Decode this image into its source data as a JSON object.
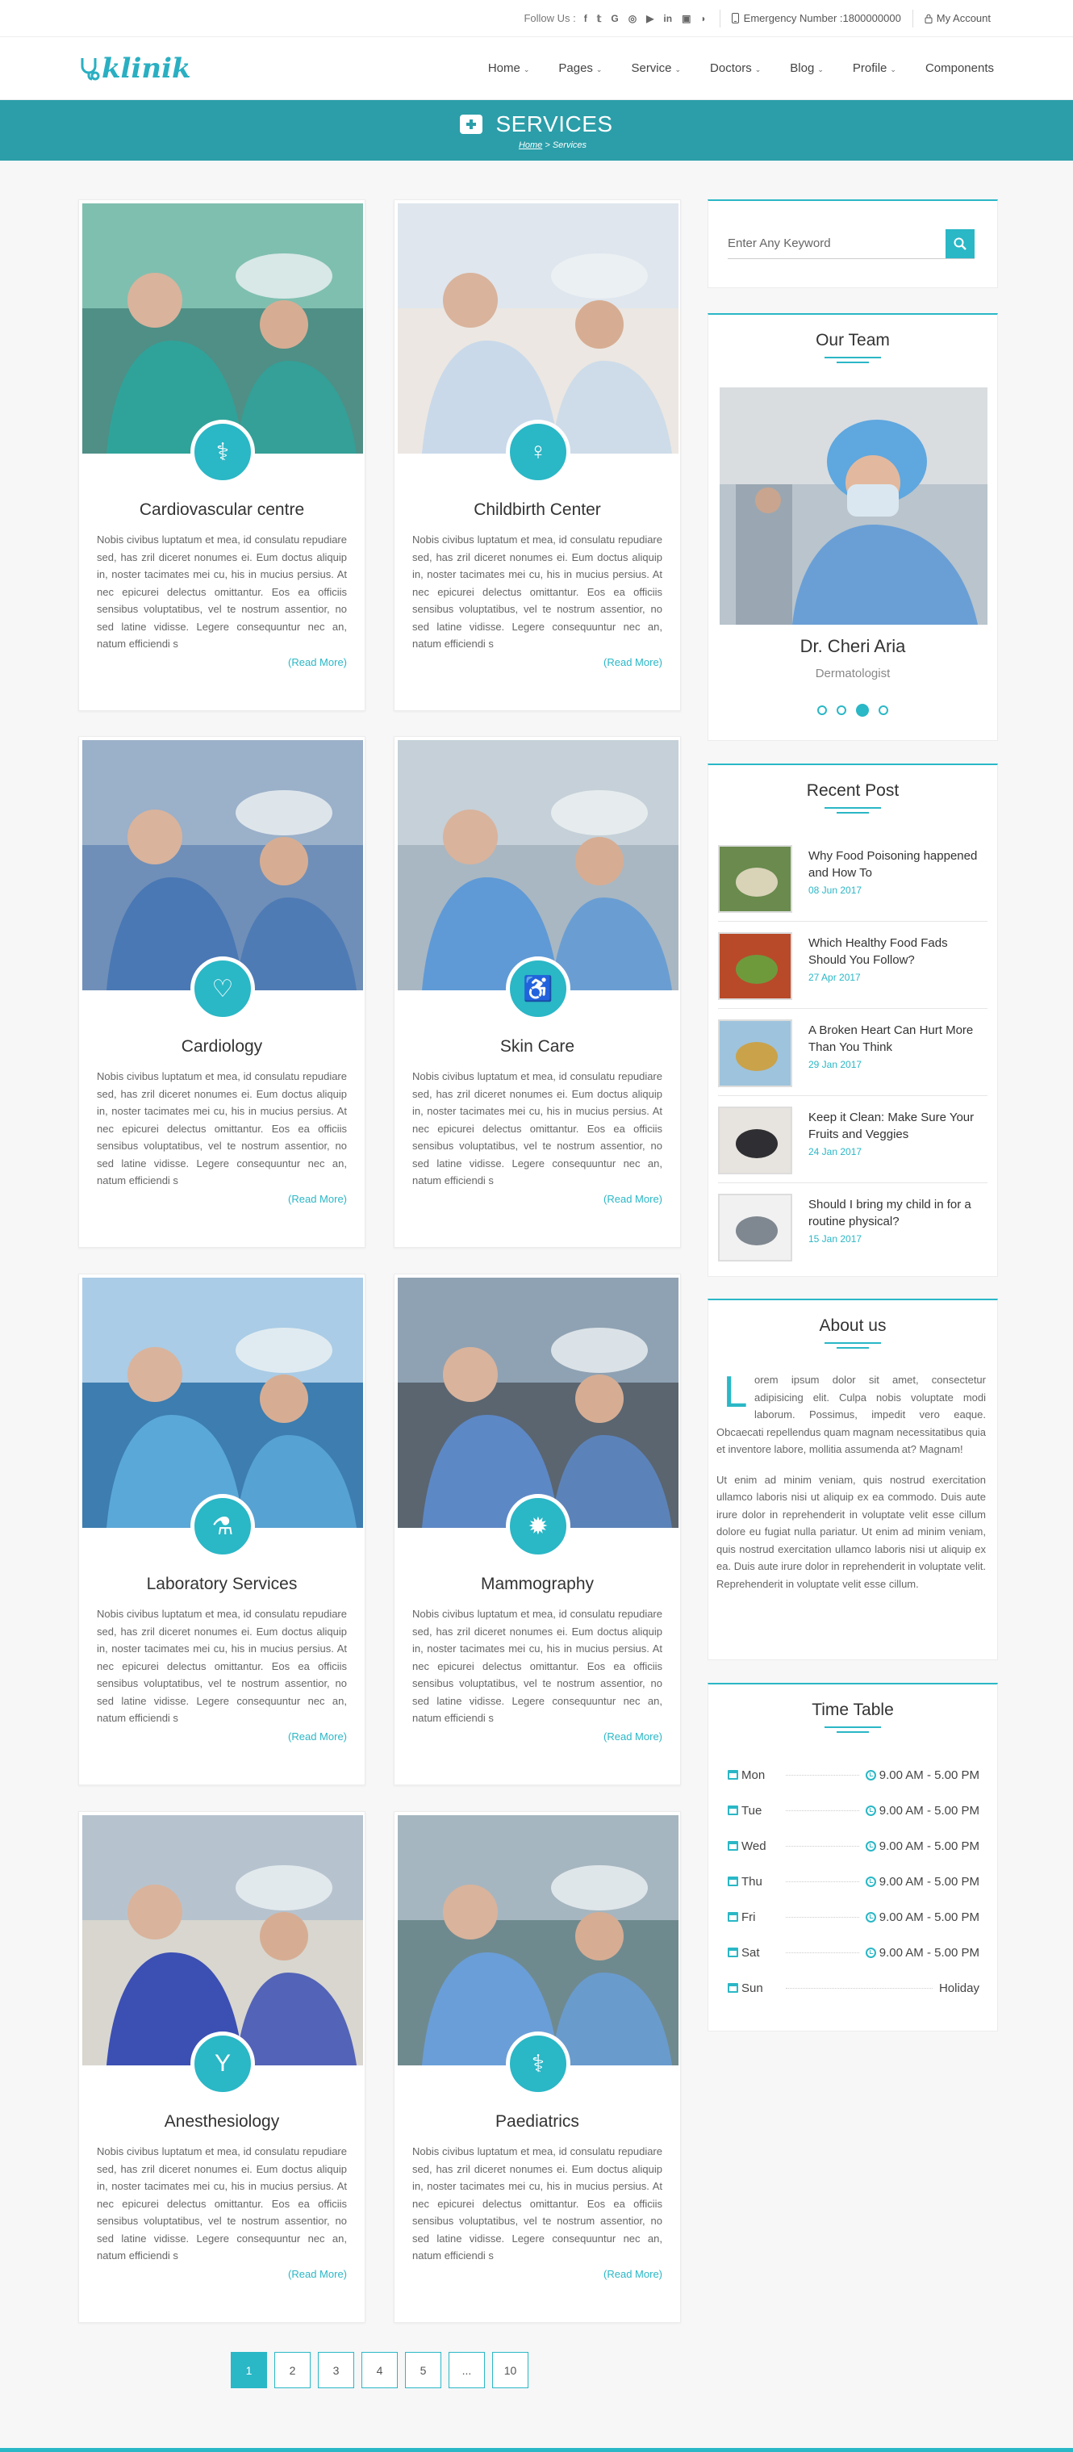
{
  "topbar": {
    "follow_label": "Follow Us :",
    "social_icons": [
      "facebook-icon",
      "twitter-icon",
      "google-icon",
      "instagram-icon",
      "youtube-icon",
      "linkedin-icon",
      "vimeo-icon",
      "rss-icon"
    ],
    "social_glyphs": [
      "f",
      "𝕥",
      "G",
      "◎",
      "▶",
      "in",
      "▣",
      "◗"
    ],
    "emergency": "Emergency Number :1800000000",
    "account": "My Account"
  },
  "header": {
    "logo": "klinik",
    "nav": [
      "Home",
      "Pages",
      "Service",
      "Doctors",
      "Blog",
      "Profile",
      "Components"
    ]
  },
  "banner": {
    "title": "SERVICES",
    "crumb_home": "Home",
    "crumb_sep": " > ",
    "crumb_current": "Services"
  },
  "services": [
    {
      "title": "Cardiovascular centre",
      "icon": "stethoscope-icon",
      "glyph": "⚕"
    },
    {
      "title": "Childbirth Center",
      "icon": "child-icon",
      "glyph": "♀"
    },
    {
      "title": "Cardiology",
      "icon": "heartbeat-icon",
      "glyph": "♡"
    },
    {
      "title": "Skin Care",
      "icon": "accessibility-icon",
      "glyph": "♿"
    },
    {
      "title": "Laboratory Services",
      "icon": "flask-icon",
      "glyph": "⚗"
    },
    {
      "title": "Mammography",
      "icon": "gear-badge-icon",
      "glyph": "✹"
    },
    {
      "title": "Anesthesiology",
      "icon": "cocktail-icon",
      "glyph": "Y"
    },
    {
      "title": "Paediatrics",
      "icon": "stethoscope-icon",
      "glyph": "⚕"
    }
  ],
  "service_text": "Nobis civibus luptatum et mea, id consulatu repudiare sed, has zril diceret nonumes ei. Eum doctus aliquip in, noster tacimates mei cu, his in mucius persius. At nec epicurei delectus omittantur. Eos ea officiis sensibus voluptatibus, vel te nostrum assentior, no sed latine vidisse. Legere consequuntur nec an, natum efficiendi s",
  "read_more": "(Read More)",
  "pagination": [
    "1",
    "2",
    "3",
    "4",
    "5",
    "...",
    "10"
  ],
  "search": {
    "placeholder": "Enter Any Keyword"
  },
  "team": {
    "title": "Our Team",
    "name": "Dr. Cheri Aria",
    "role": "Dermatologist"
  },
  "recent": {
    "title": "Recent Post",
    "posts": [
      {
        "title": "Why Food Poisoning happened and How To",
        "date": "08 Jun 2017"
      },
      {
        "title": "Which Healthy Food Fads Should You Follow?",
        "date": "27 Apr 2017"
      },
      {
        "title": "A Broken Heart Can Hurt More Than You Think",
        "date": "29 Jan 2017"
      },
      {
        "title": "Keep it Clean: Make Sure Your Fruits and Veggies",
        "date": "24 Jan 2017"
      },
      {
        "title": "Should I bring my child in for a routine physical?",
        "date": "15 Jan 2017"
      }
    ]
  },
  "about": {
    "title": "About us",
    "dropcap": "L",
    "p1": "orem ipsum dolor sit amet, consectetur adipisicing elit. Culpa nobis voluptate modi laborum. Possimus, impedit vero eaque. Obcaecati repellendus quam magnam necessitatibus quia et inventore labore, mollitia assumenda at? Magnam!",
    "p2": "Ut enim ad minim veniam, quis nostrud exercitation ullamco laboris nisi ut aliquip ex ea commodo. Duis aute irure dolor in reprehenderit in voluptate velit esse cillum dolore eu fugiat nulla pariatur. Ut enim ad minim veniam, quis nostrud exercitation ullamco laboris nisi ut aliquip ex ea. Duis aute irure dolor in reprehenderit in voluptate velit. Reprehenderit in voluptate velit esse cillum."
  },
  "timetable": {
    "title": "Time Table",
    "rows": [
      {
        "day": "Mon",
        "hours": "9.00 AM - 5.00 PM"
      },
      {
        "day": "Tue",
        "hours": "9.00 AM - 5.00 PM"
      },
      {
        "day": "Wed",
        "hours": "9.00 AM - 5.00 PM"
      },
      {
        "day": "Thu",
        "hours": "9.00 AM - 5.00 PM"
      },
      {
        "day": "Fri",
        "hours": "9.00 AM - 5.00 PM"
      },
      {
        "day": "Sat",
        "hours": "9.00 AM - 5.00 PM"
      },
      {
        "day": "Sun",
        "hours": "Holiday"
      }
    ]
  },
  "colors": {
    "accent": "#2ab7c6",
    "banner": "#2b9ea9"
  }
}
